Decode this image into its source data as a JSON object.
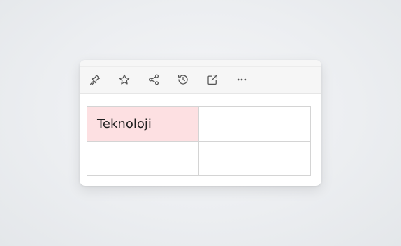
{
  "toolbar": {
    "buttons": [
      {
        "name": "pin-button",
        "icon": "pin-icon"
      },
      {
        "name": "star-button",
        "icon": "star-icon"
      },
      {
        "name": "share-button",
        "icon": "share-icon"
      },
      {
        "name": "history-button",
        "icon": "history-icon"
      },
      {
        "name": "open-external-button",
        "icon": "external-link-icon"
      },
      {
        "name": "more-button",
        "icon": "more-horizontal-icon"
      }
    ],
    "icon_color": "#555555"
  },
  "table": {
    "rows": [
      [
        "Teknoloji",
        ""
      ],
      [
        "",
        ""
      ]
    ],
    "highlight_color": "#fde0e2",
    "border_color": "#d4d4d4"
  }
}
